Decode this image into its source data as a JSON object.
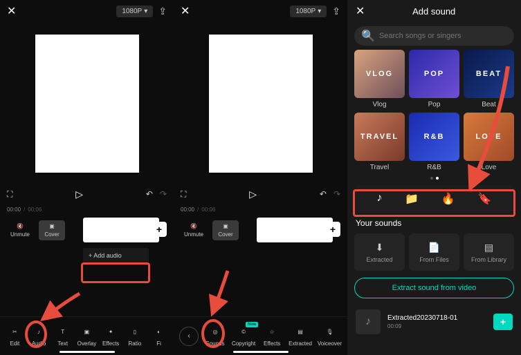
{
  "topbar": {
    "resolution": "1080P"
  },
  "playbar": {
    "current_time_short": "00:00",
    "total_time_short": "00:06"
  },
  "controls": {
    "unmute": "Unmute",
    "cover": "Cover",
    "add_audio": "+  Add audio"
  },
  "toolbar1": [
    {
      "label": "Edit"
    },
    {
      "label": "Audio"
    },
    {
      "label": "Text"
    },
    {
      "label": "Overlay"
    },
    {
      "label": "Effects"
    },
    {
      "label": "Ratio"
    },
    {
      "label": "Fi"
    }
  ],
  "toolbar2": [
    {
      "label": "Sounds"
    },
    {
      "label": "Copyright",
      "badge": "New"
    },
    {
      "label": "Effects"
    },
    {
      "label": "Extracted"
    },
    {
      "label": "Voiceover"
    }
  ],
  "p3": {
    "title": "Add sound",
    "search_placeholder": "Search songs or singers",
    "categories_row1": [
      {
        "overlay": "VLOG",
        "label": "Vlog",
        "bg": "linear-gradient(135deg,#d9a37e,#6e4f5a)"
      },
      {
        "overlay": "POP",
        "label": "Pop",
        "bg": "linear-gradient(135deg,#2b2aa8,#6f4fd6)"
      },
      {
        "overlay": "BEAT",
        "label": "Beat",
        "bg": "linear-gradient(135deg,#0a1a4a,#1a3a8a)"
      }
    ],
    "categories_row2": [
      {
        "overlay": "TRAVEL",
        "label": "Travel",
        "bg": "linear-gradient(135deg,#c97a5a,#7a3a2a)"
      },
      {
        "overlay": "R&B",
        "label": "R&B",
        "bg": "linear-gradient(135deg,#1a2ab0,#3a5ae0)"
      },
      {
        "overlay": "LOVE",
        "label": "Love",
        "bg": "linear-gradient(135deg,#d97a3a,#a04a2a)"
      }
    ],
    "your_sounds": "Your sounds",
    "sources": [
      {
        "label": "Extracted"
      },
      {
        "label": "From Files"
      },
      {
        "label": "From Library"
      }
    ],
    "extract_label": "Extract sound from video",
    "sound_item": {
      "name": "Extracted20230718-01",
      "duration": "00:09"
    }
  }
}
